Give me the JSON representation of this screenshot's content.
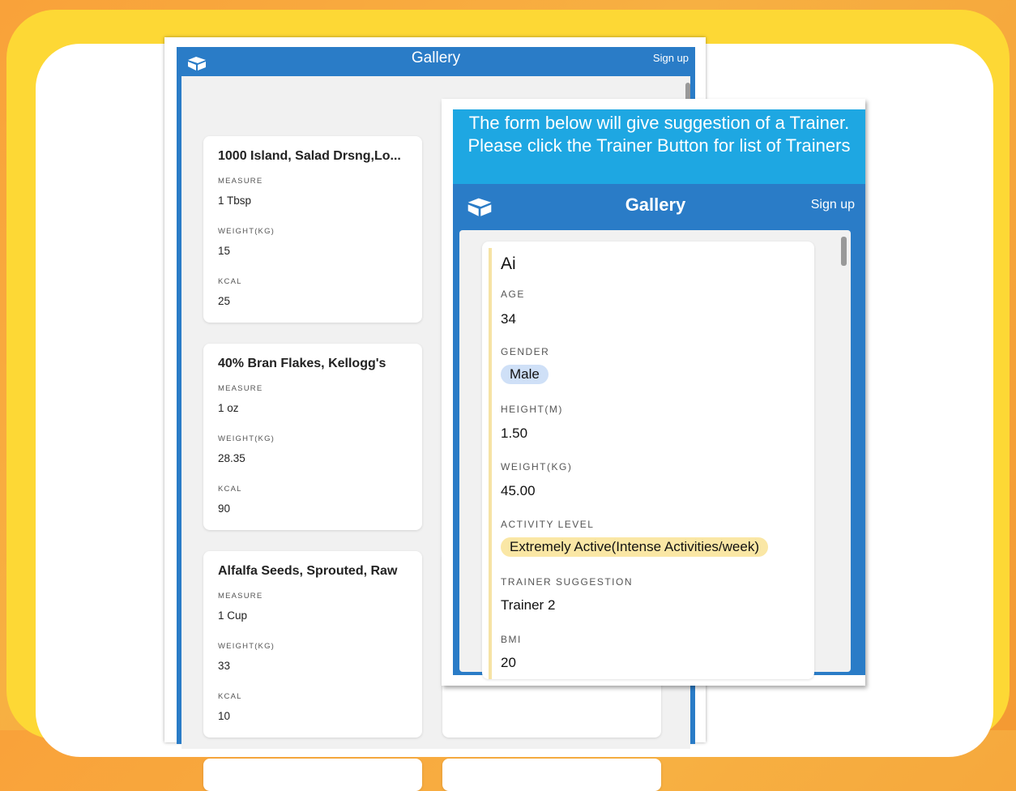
{
  "app": {
    "title": "Gallery",
    "signup_label": "Sign up"
  },
  "food_items": [
    {
      "name": "1000 Island, Salad Drsng,Lo...",
      "measure_label": "MEASURE",
      "measure": "1 Tbsp",
      "weight_label": "WEIGHT(KG)",
      "weight": "15",
      "kcal_label": "KCAL",
      "kcal": "25"
    },
    {
      "name": "40% Bran Flakes, Kellogg's",
      "measure_label": "MEASURE",
      "measure": "1 oz",
      "weight_label": "WEIGHT(KG)",
      "weight": "28.35",
      "kcal_label": "KCAL",
      "kcal": "90"
    },
    {
      "name": "Alfalfa Seeds, Sprouted, Raw",
      "measure_label": "MEASURE",
      "measure": "1 Cup",
      "weight_label": "WEIGHT(KG)",
      "weight": "33",
      "kcal_label": "KCAL",
      "kcal": "10"
    }
  ],
  "popup": {
    "banner_text": "The form below will give suggestion of a Trainer. Please click the Trainer Button for list of Trainers",
    "title": "Gallery",
    "signup_label": "Sign up",
    "trainer_record": {
      "name": "Ai",
      "age_label": "AGE",
      "age": "34",
      "gender_label": "GENDER",
      "gender": "Male",
      "height_label": "HEIGHT(M)",
      "height": "1.50",
      "weight_label": "WEIGHT(KG)",
      "weight": "45.00",
      "activity_label": "ACTIVITY LEVEL",
      "activity": "Extremely Active(Intense Activities/week)",
      "suggestion_label": "TRAINER SUGGESTION",
      "suggestion": "Trainer 2",
      "bmi_label": "BMI",
      "bmi": "20"
    }
  },
  "colors": {
    "header_blue": "#2a7cc7",
    "banner_blue": "#1ea7e2",
    "frame_yellow": "#fdd835",
    "gender_pill": "#cfe0f7",
    "activity_pill": "#fae7a5"
  },
  "icons": {
    "logo": "cube-logo-icon"
  }
}
